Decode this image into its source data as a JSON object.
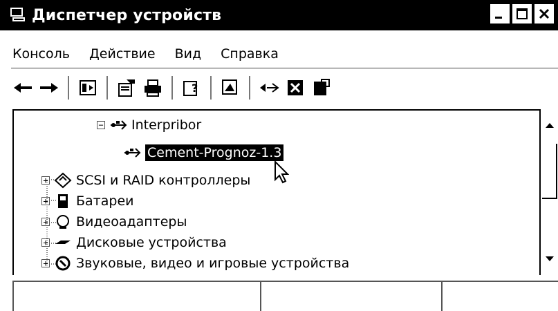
{
  "window": {
    "title": "Диспетчер устройств",
    "title_icon": "computer-icon"
  },
  "menu": [
    "Консоль",
    "Действие",
    "Вид",
    "Справка"
  ],
  "toolbar": [
    {
      "name": "back-icon"
    },
    {
      "name": "forward-icon"
    },
    {
      "name": "show-hide-console-tree-icon"
    },
    {
      "name": "properties-icon"
    },
    {
      "name": "print-icon"
    },
    {
      "name": "help-icon"
    },
    {
      "name": "scan-hardware-icon"
    },
    {
      "name": "update-driver-icon"
    },
    {
      "name": "disable-device-icon"
    },
    {
      "name": "uninstall-device-icon"
    }
  ],
  "tree": [
    {
      "expander": "−",
      "icon": "usb-icon",
      "label": "Interpribor",
      "level": 0
    },
    {
      "expander": "",
      "icon": "usb-icon",
      "label": "Cement-Prognoz-1.3",
      "level": 1,
      "selected": true
    },
    {
      "expander": "+",
      "icon": "scsi-controller-icon",
      "label": "SCSI и RAID контроллеры",
      "level": 0
    },
    {
      "expander": "+",
      "icon": "battery-icon",
      "label": "Батареи",
      "level": 0
    },
    {
      "expander": "+",
      "icon": "display-adapter-icon",
      "label": "Видеоадаптеры",
      "level": 0
    },
    {
      "expander": "+",
      "icon": "disk-drive-icon",
      "label": "Дисковые устройства",
      "level": 0
    },
    {
      "expander": "+",
      "icon": "sound-icon",
      "label": "Звуковые, видео и игровые устройства",
      "level": 0
    }
  ],
  "status": [
    "",
    "",
    ""
  ]
}
